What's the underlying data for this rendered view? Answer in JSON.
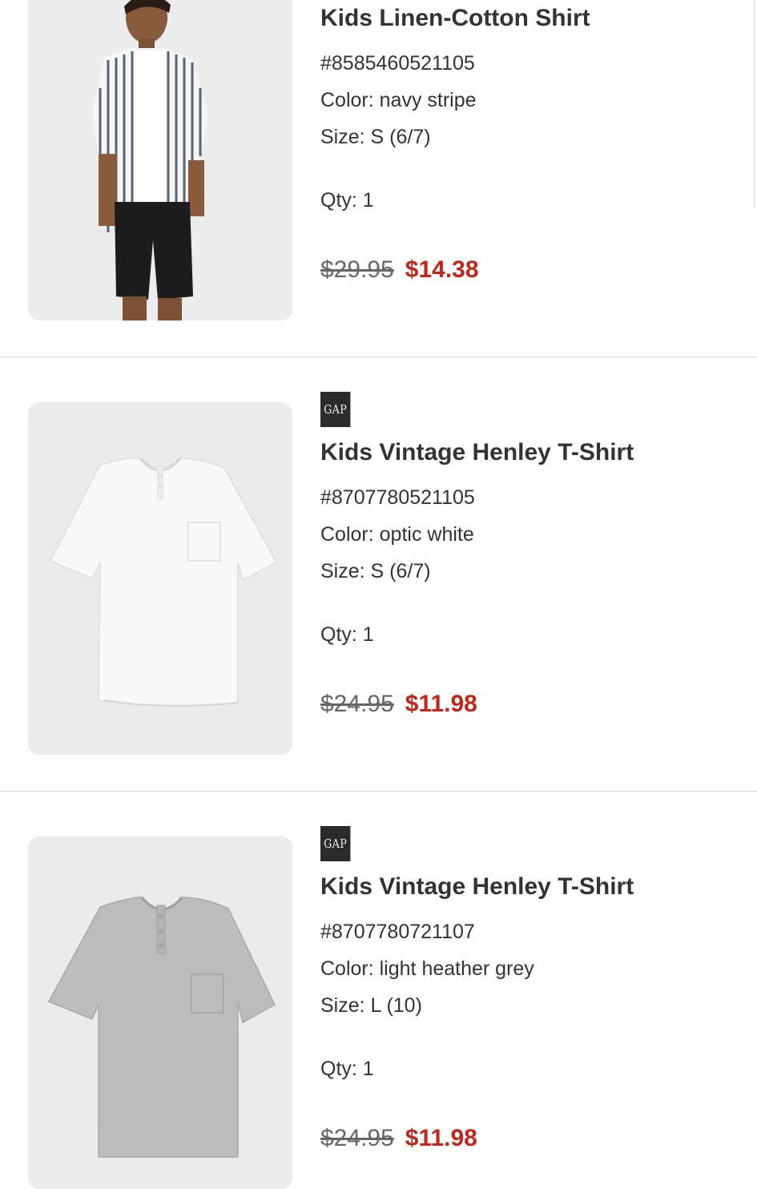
{
  "items": [
    {
      "title": "Kids Linen-Cotton Shirt",
      "sku": "#8585460521105",
      "color": "Color: navy stripe",
      "size": "Size: S (6/7)",
      "qty": "Qty: 1",
      "price_original": "$29.95",
      "price_sale": "$14.38",
      "image": "boy-in-striped-shirt-photo"
    },
    {
      "brand": "GAP",
      "title": "Kids Vintage Henley T-Shirt",
      "sku": "#8707780521105",
      "color": "Color: optic white",
      "size": "Size: S (6/7)",
      "qty": "Qty: 1",
      "price_original": "$24.95",
      "price_sale": "$11.98",
      "image": "white-henley-tshirt-photo"
    },
    {
      "brand": "GAP",
      "title": "Kids Vintage Henley T-Shirt",
      "sku": "#8707780721107",
      "color": "Color: light heather grey",
      "size": "Size: L (10)",
      "qty": "Qty: 1",
      "price_original": "$24.95",
      "price_sale": "$11.98",
      "image": "grey-henley-tshirt-photo"
    }
  ],
  "colors": {
    "sale_price": "#c0271a",
    "text": "#333333",
    "divider": "#d8d8d8",
    "brand_logo_bg": "#2b2b2b"
  }
}
